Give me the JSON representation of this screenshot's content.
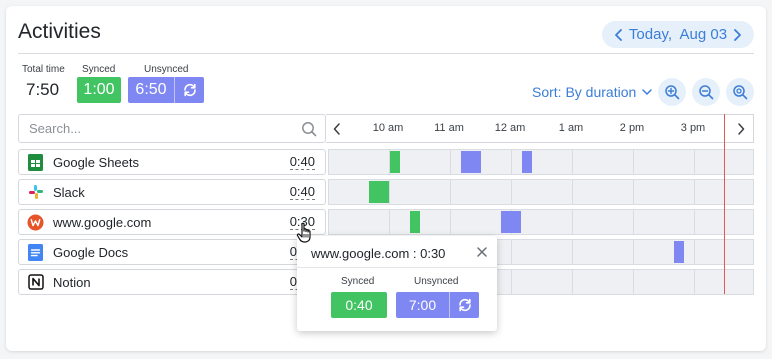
{
  "header": {
    "title": "Activities",
    "date_label": "Today,  Aug 03"
  },
  "stats": {
    "total_label": "Total time",
    "total_value": "7:50",
    "synced_label": "Synced",
    "synced_value": "1:00",
    "unsynced_label": "Unsynced",
    "unsynced_value": "6:50"
  },
  "toolbar": {
    "sort_label": "Sort: By duration"
  },
  "search": {
    "placeholder": "Search..."
  },
  "timeline": {
    "hours": [
      "10 am",
      "11 am",
      "12 am",
      "1 am",
      "2 pm",
      "3 pm"
    ]
  },
  "activities": [
    {
      "name": "Google Sheets",
      "duration": "0:40",
      "icon": "google-sheets-icon"
    },
    {
      "name": "Slack",
      "duration": "0:40",
      "icon": "slack-icon"
    },
    {
      "name": "www.google.com",
      "duration": "0:30",
      "icon": "website-w-icon"
    },
    {
      "name": "Google Docs",
      "duration": "0:30",
      "icon": "google-docs-icon"
    },
    {
      "name": "Notion",
      "duration": "0:30",
      "icon": "notion-icon"
    }
  ],
  "popover": {
    "title": "www.google.com : 0:30",
    "synced_label": "Synced",
    "synced_value": "0:40",
    "unsynced_label": "Unsynced",
    "unsynced_value": "7:00"
  },
  "colors": {
    "accent": "#3b7dd8",
    "synced": "#43c463",
    "unsynced": "#7f87f3",
    "now_line": "#e25757"
  }
}
